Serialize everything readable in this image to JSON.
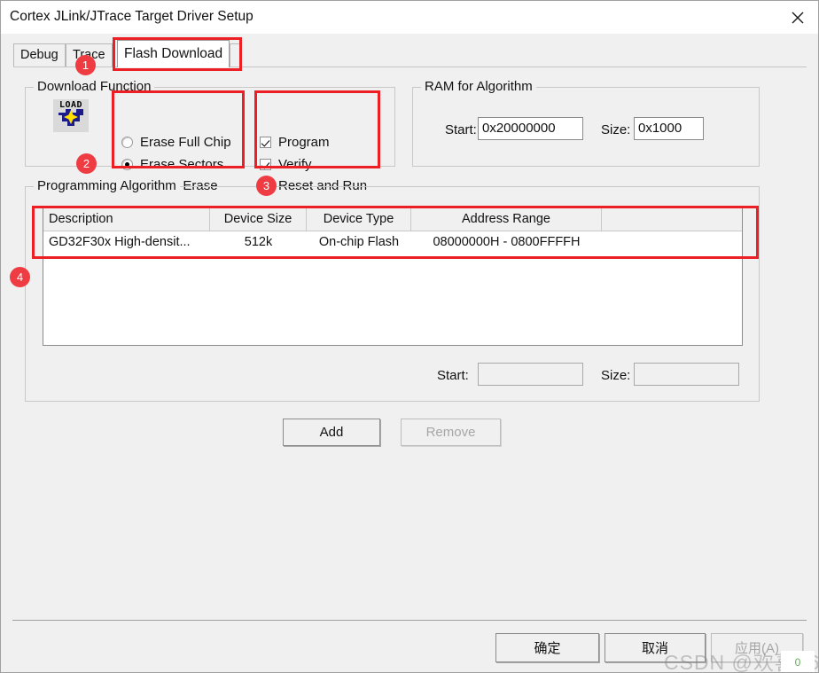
{
  "window": {
    "title": "Cortex JLink/JTrace Target Driver Setup",
    "close_icon": "close-icon"
  },
  "tabs": [
    {
      "label": "Debug",
      "selected": false
    },
    {
      "label": "Trace",
      "selected": false
    },
    {
      "label": "Flash Download",
      "selected": true
    }
  ],
  "download_function": {
    "title": "Download Function",
    "icon_label": "LOAD",
    "erase_options": [
      {
        "label": "Erase Full Chip",
        "selected": false
      },
      {
        "label": "Erase Sectors",
        "selected": true
      },
      {
        "label": "Do not Erase",
        "selected": false
      }
    ],
    "checkboxes": [
      {
        "label": "Program",
        "checked": true
      },
      {
        "label": "Verify",
        "checked": true
      },
      {
        "label": "Reset and Run",
        "checked": false
      }
    ]
  },
  "ram_for_algorithm": {
    "title": "RAM for Algorithm",
    "start_label": "Start:",
    "start_value": "0x20000000",
    "size_label": "Size:",
    "size_value": "0x1000"
  },
  "programming_algorithm": {
    "title": "Programming Algorithm",
    "columns": [
      "Description",
      "Device Size",
      "Device Type",
      "Address Range",
      ""
    ],
    "rows": [
      {
        "description": "GD32F30x High-densit...",
        "device_size": "512k",
        "device_type": "On-chip Flash",
        "address_range": "08000000H - 0800FFFFH"
      }
    ],
    "start_label": "Start:",
    "start_value": "",
    "size_label": "Size:",
    "size_value": "",
    "add_label": "Add",
    "remove_label": "Remove"
  },
  "dialog_buttons": [
    {
      "label": "确定",
      "disabled": false
    },
    {
      "label": "取消",
      "disabled": false
    },
    {
      "label": "应用(A)",
      "disabled": true
    }
  ],
  "annotations": {
    "badges": [
      "1",
      "2",
      "3",
      "4"
    ]
  },
  "watermark": {
    "text": "CSDN @欢喜6666",
    "badge": "0"
  },
  "colors": {
    "annotation_red": "#ec2024",
    "badge_red": "#ef3b42",
    "dialog_bg": "#f0f0f0"
  }
}
